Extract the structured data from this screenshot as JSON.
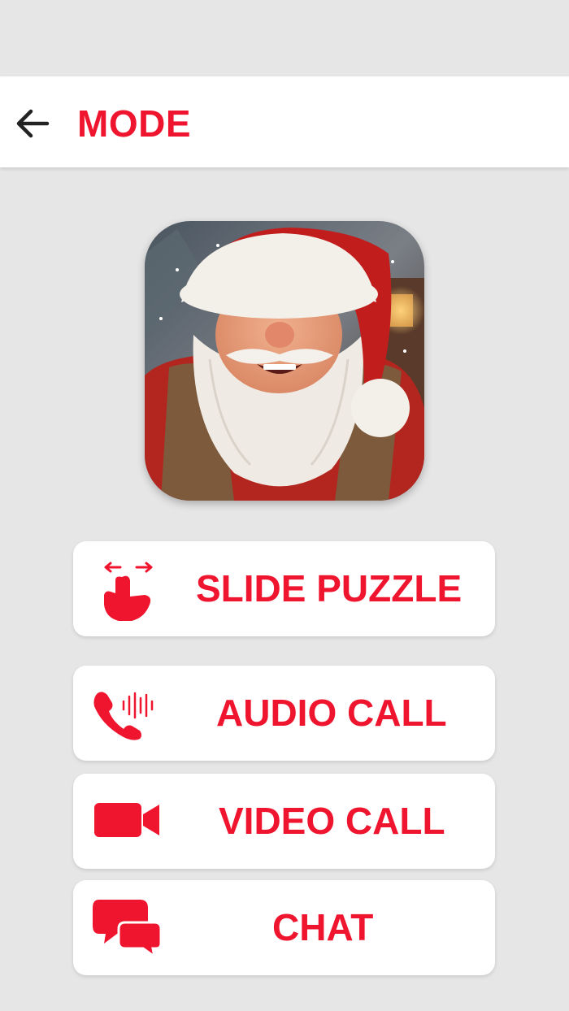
{
  "header": {
    "title": "MODE",
    "back_icon": "arrow-left-icon"
  },
  "avatar": {
    "subject": "santa-claus-photo"
  },
  "modes": [
    {
      "label": "SLIDE PUZZLE",
      "icon": "swipe-hand-icon"
    },
    {
      "label": "AUDIO CALL",
      "icon": "phone-call-icon"
    },
    {
      "label": "VIDEO CALL",
      "icon": "video-camera-icon"
    },
    {
      "label": "CHAT",
      "icon": "chat-bubbles-icon"
    }
  ],
  "colors": {
    "accent": "#f0152f",
    "background": "#e6e6e6",
    "card": "#ffffff"
  }
}
